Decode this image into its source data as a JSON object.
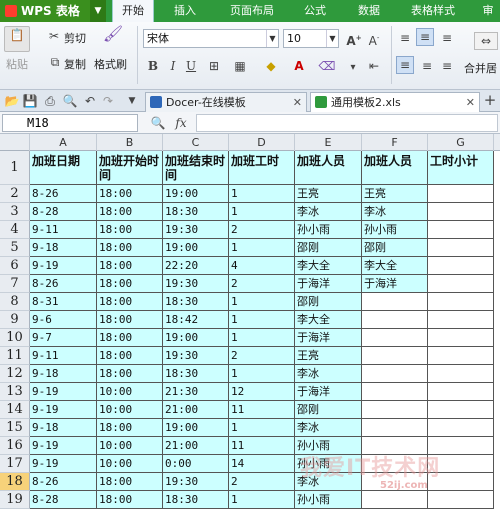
{
  "app": {
    "title": "WPS 表格"
  },
  "menu": [
    "开始",
    "插入",
    "页面布局",
    "公式",
    "数据",
    "表格样式",
    "审"
  ],
  "ribbon": {
    "cut": "剪切",
    "paste": "粘贴",
    "copy": "复制",
    "format_painter": "格式刷",
    "font": "宋体",
    "size": "10",
    "merge": "合并居"
  },
  "tabs": [
    "Docer-在线模板",
    "通用模板2.xls"
  ],
  "formula": {
    "name_box": "M18",
    "fx": "fx"
  },
  "columns": [
    "A",
    "B",
    "C",
    "D",
    "E",
    "F",
    "G"
  ],
  "header_row": [
    "加班日期",
    "加班开始时间",
    "加班结束时间",
    "加班工时",
    "加班人员",
    "加班人员",
    "工时小计"
  ],
  "rows": [
    [
      "8-26",
      "18:00",
      "19:00",
      "1",
      "王亮",
      "王亮",
      ""
    ],
    [
      "8-28",
      "18:00",
      "18:30",
      "1",
      "李冰",
      "李冰",
      ""
    ],
    [
      "9-11",
      "18:00",
      "19:30",
      "2",
      "孙小雨",
      "孙小雨",
      ""
    ],
    [
      "9-18",
      "18:00",
      "19:00",
      "1",
      "邵刚",
      "邵刚",
      ""
    ],
    [
      "9-19",
      "18:00",
      "22:20",
      "4",
      "李大全",
      "李大全",
      ""
    ],
    [
      "8-26",
      "18:00",
      "19:30",
      "2",
      "于海洋",
      "于海洋",
      ""
    ],
    [
      "8-31",
      "18:00",
      "18:30",
      "1",
      "邵刚",
      "",
      ""
    ],
    [
      "9-6",
      "18:00",
      "18:42",
      "1",
      "李大全",
      "",
      ""
    ],
    [
      "9-7",
      "18:00",
      "19:00",
      "1",
      "于海洋",
      "",
      ""
    ],
    [
      "9-11",
      "18:00",
      "19:30",
      "2",
      "王亮",
      "",
      ""
    ],
    [
      "9-18",
      "18:00",
      "18:30",
      "1",
      "李冰",
      "",
      ""
    ],
    [
      "9-19",
      "10:00",
      "21:30",
      "12",
      "于海洋",
      "",
      ""
    ],
    [
      "9-19",
      "10:00",
      "21:00",
      "11",
      "邵刚",
      "",
      ""
    ],
    [
      "9-18",
      "18:00",
      "19:00",
      "1",
      "李冰",
      "",
      ""
    ],
    [
      "9-19",
      "10:00",
      "21:00",
      "11",
      "孙小雨",
      "",
      ""
    ],
    [
      "9-19",
      "10:00",
      "0:00",
      "14",
      "孙小雨",
      "",
      ""
    ],
    [
      "8-26",
      "18:00",
      "19:30",
      "2",
      "李冰",
      "",
      ""
    ],
    [
      "8-28",
      "18:00",
      "18:30",
      "1",
      "孙小雨",
      "",
      ""
    ]
  ],
  "row_numbers": [
    "1",
    "2",
    "3",
    "4",
    "5",
    "6",
    "7",
    "8",
    "9",
    "10",
    "11",
    "12",
    "13",
    "14",
    "15",
    "16",
    "17",
    "18",
    "19"
  ],
  "selected_row": "18",
  "watermark": {
    "text": "我爱IT技术网",
    "url": "52ij.com"
  },
  "colors": {
    "accent": "#2f9a3c",
    "cell_fill": "#ccffff",
    "selected_row": "#f7d27a"
  }
}
